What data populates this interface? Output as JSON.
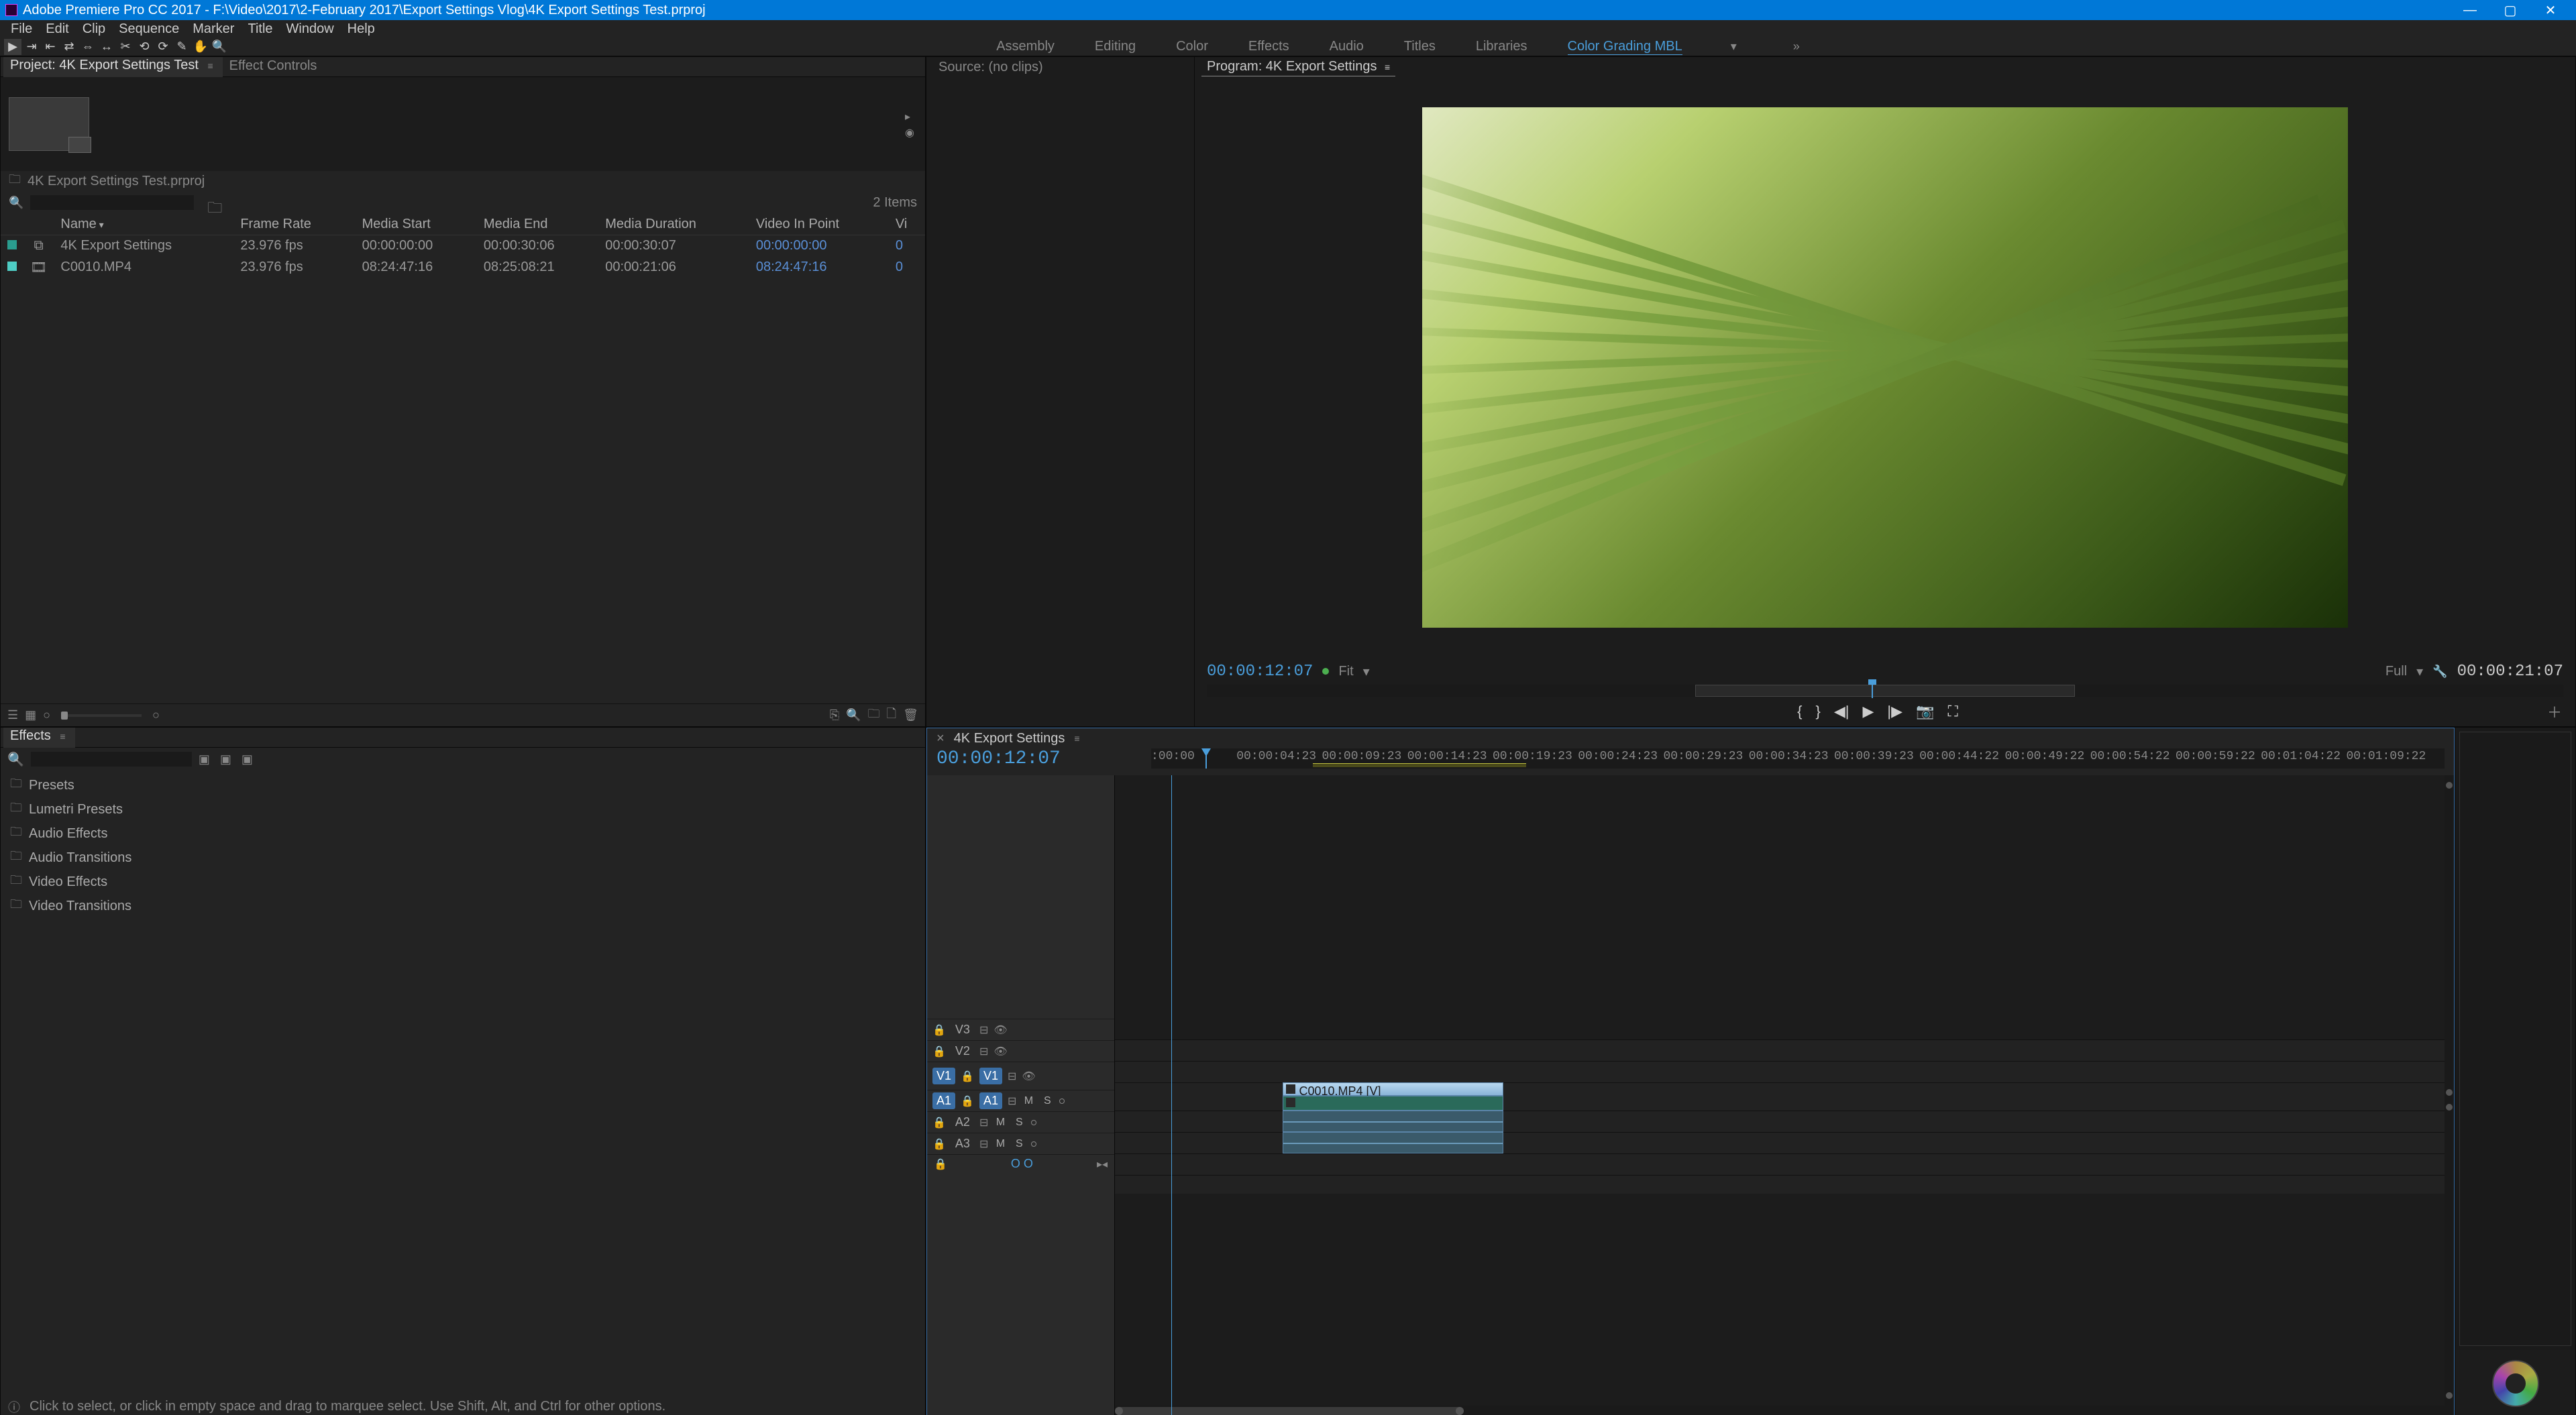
{
  "titlebar": {
    "text": "Adobe Premiere Pro CC 2017 - F:\\Video\\2017\\2-February 2017\\Export Settings Vlog\\4K Export Settings Test.prproj"
  },
  "menubar": [
    "File",
    "Edit",
    "Clip",
    "Sequence",
    "Marker",
    "Title",
    "Window",
    "Help"
  ],
  "workspaces": {
    "tabs": [
      "Assembly",
      "Editing",
      "Color",
      "Effects",
      "Audio",
      "Titles",
      "Libraries",
      "Color Grading MBL"
    ],
    "active": "Color Grading MBL",
    "extra": "»"
  },
  "project_panel": {
    "tabs": {
      "project": "Project: 4K Export Settings Test",
      "effect_controls": "Effect Controls"
    },
    "path_row": {
      "file": "4K Export Settings Test.prproj"
    },
    "items_count": "2 Items",
    "columns": [
      "Name",
      "Frame Rate",
      "Media Start",
      "Media End",
      "Media Duration",
      "Video In Point",
      "Vi"
    ],
    "rows": [
      {
        "name": "4K Export Settings",
        "frame_rate": "23.976 fps",
        "media_start": "00:00:00:00",
        "media_end": "00:00:30:06",
        "media_duration": "00:00:30:07",
        "in_point": "00:00:00:00",
        "vi": "0"
      },
      {
        "name": "C0010.MP4",
        "frame_rate": "23.976 fps",
        "media_start": "08:24:47:16",
        "media_end": "08:25:08:21",
        "media_duration": "00:00:21:06",
        "in_point": "08:24:47:16",
        "vi": "0"
      }
    ]
  },
  "source_monitor": {
    "tab": "Source: (no clips)"
  },
  "program_monitor": {
    "tab": "Program: 4K Export Settings",
    "current_tc": "00:00:12:07",
    "fit_label": "Fit",
    "full_label": "Full",
    "end_tc": "00:00:21:07"
  },
  "effects_panel": {
    "tab": "Effects",
    "tree": [
      "Presets",
      "Lumetri Presets",
      "Audio Effects",
      "Audio Transitions",
      "Video Effects",
      "Video Transitions"
    ]
  },
  "timeline": {
    "seq_name": "4K Export Settings",
    "current_tc": "00:00:12:07",
    "ruler_labels": [
      ":00:00",
      "00:00:04:23",
      "00:00:09:23",
      "00:00:14:23",
      "00:00:19:23",
      "00:00:24:23",
      "00:00:29:23",
      "00:00:34:23",
      "00:00:39:23",
      "00:00:44:22",
      "00:00:49:22",
      "00:00:54:22",
      "00:00:59:22",
      "00:01:04:22",
      "00:01:09:22"
    ],
    "tracks": {
      "v3": "V3",
      "v2": "V2",
      "v1_src": "V1",
      "v1": "V1",
      "a1_src": "A1",
      "a1": "A1",
      "a2": "A2",
      "a3": "A3",
      "m": "M",
      "s": "S"
    },
    "clip_label": "C0010.MP4 [V]",
    "zoom_label": "O O"
  },
  "statusbar": {
    "text": "Click to select, or click in empty space and drag to marquee select. Use Shift, Alt, and Ctrl for other options."
  }
}
